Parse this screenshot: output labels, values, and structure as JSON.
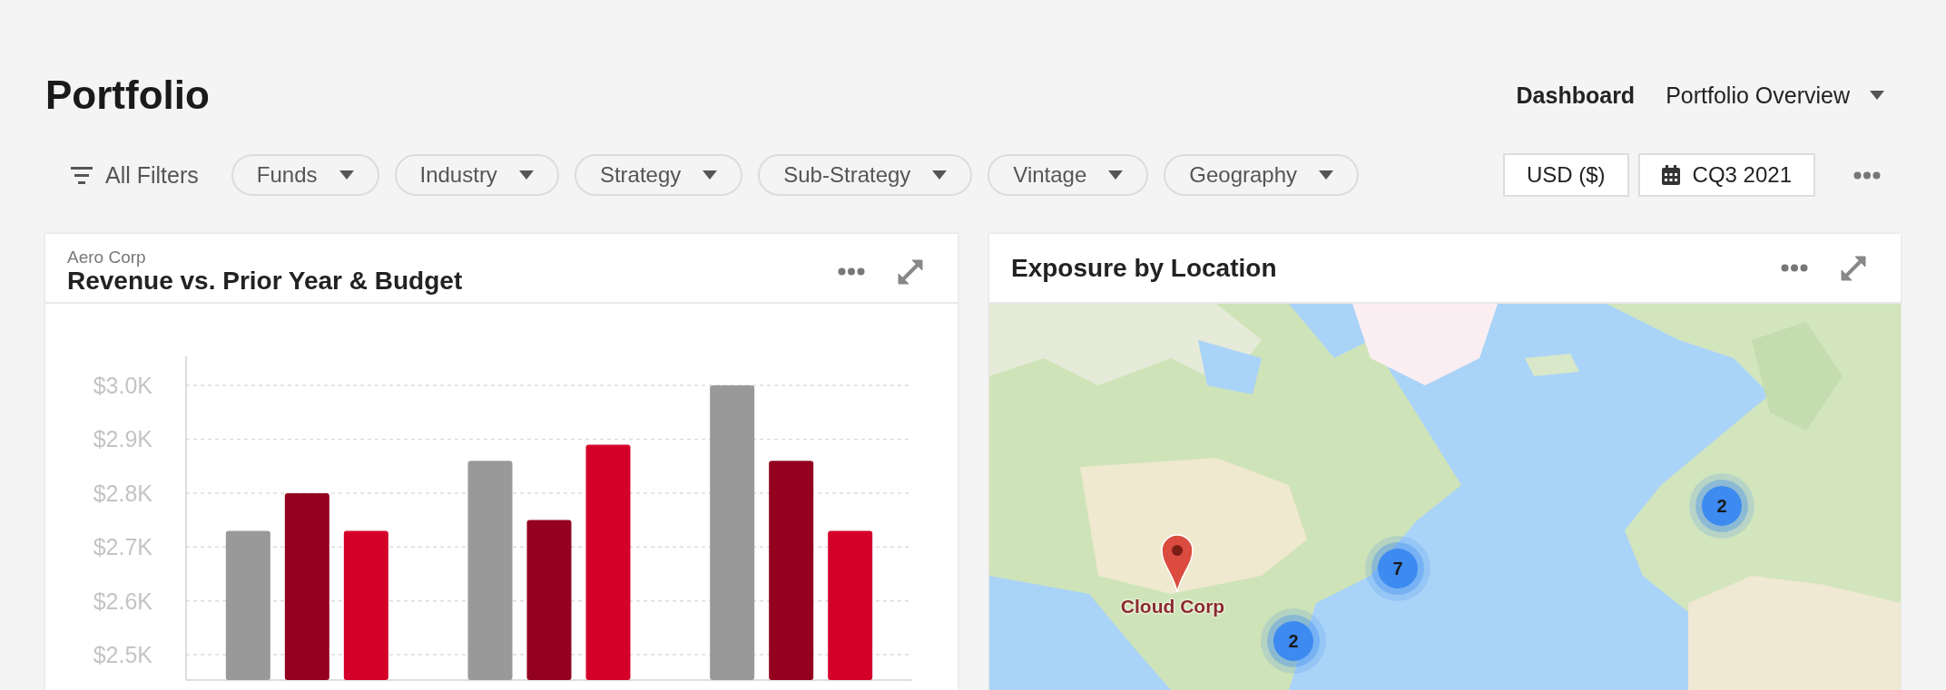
{
  "page": {
    "title": "Portfolio"
  },
  "nav": [
    {
      "label": "Dashboard",
      "selected": true
    },
    {
      "label": "Portfolio Overview",
      "selected": false
    }
  ],
  "filters": {
    "all_label": "All Filters",
    "items": [
      "Funds",
      "Industry",
      "Strategy",
      "Sub-Strategy",
      "Vintage",
      "Geography"
    ],
    "currency": "USD ($)",
    "period": "CQ3 2021"
  },
  "revenue_card": {
    "subtitle": "Aero Corp",
    "title": "Revenue vs. Prior Year & Budget",
    "chart_data": {
      "type": "bar",
      "ylim": [
        2.453,
        3.054
      ],
      "grid": true,
      "yticks": [
        {
          "value": 2.5,
          "label": "$2.5K"
        },
        {
          "value": 2.6,
          "label": "$2.6K"
        },
        {
          "value": 2.7,
          "label": "$2.7K"
        },
        {
          "value": 2.8,
          "label": "$2.8K"
        },
        {
          "value": 2.9,
          "label": "$2.9K"
        },
        {
          "value": 3.0,
          "label": "$3.0K"
        }
      ],
      "series": [
        {
          "color": "#999999",
          "values": [
            2.73,
            2.86,
            3.0
          ]
        },
        {
          "color": "#94001f",
          "values": [
            2.8,
            2.75,
            2.86
          ]
        },
        {
          "color": "#d5002a",
          "values": [
            2.73,
            2.89,
            2.73
          ]
        }
      ]
    }
  },
  "map_card": {
    "title": "Exposure by Location",
    "markers": [
      {
        "kind": "pin",
        "label": "Cloud Corp"
      },
      {
        "kind": "cluster",
        "label": "7"
      },
      {
        "kind": "cluster",
        "label": "2"
      },
      {
        "kind": "cluster",
        "label": "2"
      }
    ]
  }
}
